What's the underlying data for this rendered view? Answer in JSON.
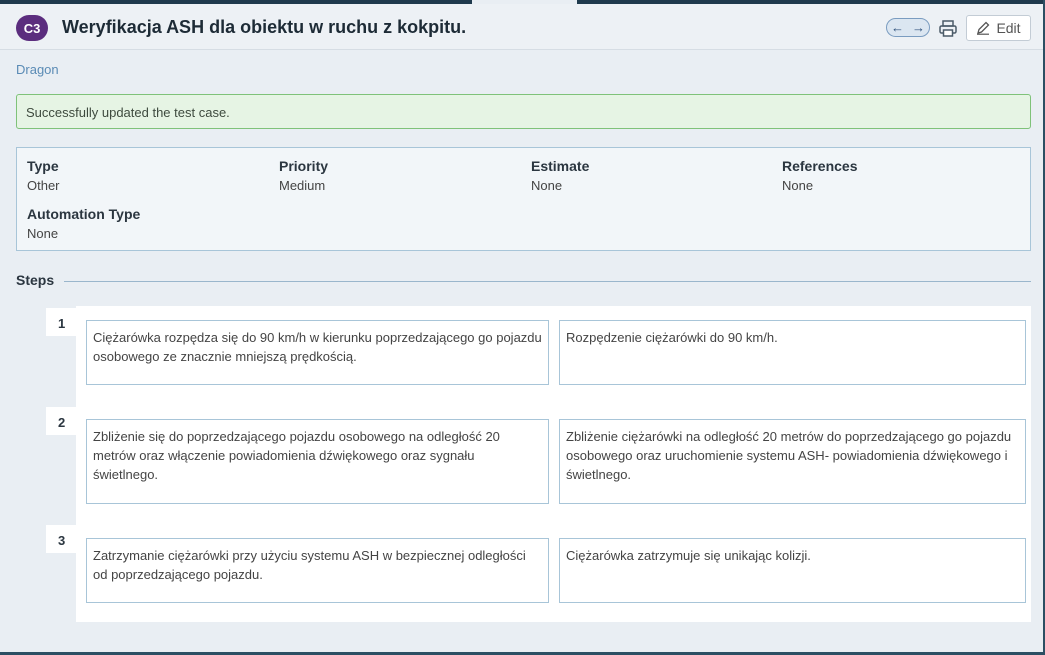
{
  "header": {
    "badge": "C3",
    "title": "Weryfikacja ASH dla obiektu w ruchu z kokpitu.",
    "edit_label": "Edit"
  },
  "icons": {
    "prev": "arrow-left-icon",
    "next": "arrow-right-icon",
    "print": "printer-icon",
    "edit": "pencil-icon"
  },
  "breadcrumb": "Dragon",
  "alert": "Successfully updated the test case.",
  "properties": [
    {
      "label": "Type",
      "value": "Other"
    },
    {
      "label": "Priority",
      "value": "Medium"
    },
    {
      "label": "Estimate",
      "value": "None"
    },
    {
      "label": "References",
      "value": "None"
    },
    {
      "label": "Automation Type",
      "value": "None"
    }
  ],
  "steps_title": "Steps",
  "steps": [
    {
      "number": "1",
      "action": "Ciężarówka rozpędza się do 90 km/h w kierunku poprzedzającego go pojazdu osobowego ze znacznie mniejszą prędkością.",
      "expected": "Rozpędzenie ciężarówki do 90 km/h."
    },
    {
      "number": "2",
      "action": "Zbliżenie się do poprzedzającego pojazdu osobowego na odległość 20 metrów oraz włączenie powiadomienia dźwiękowego oraz sygnału świetlnego.",
      "expected": "Zbliżenie ciężarówki na odległość 20 metrów do poprzedzającego go pojazdu osobowego oraz uruchomienie systemu ASH- powiadomienia dźwiękowego i świetlnego."
    },
    {
      "number": "3",
      "action": "Zatrzymanie ciężarówki przy użyciu systemu ASH w bezpiecznej odległości od poprzedzającego pojazdu.",
      "expected": "Ciężarówka zatrzymuje się unikając kolizji."
    }
  ]
}
